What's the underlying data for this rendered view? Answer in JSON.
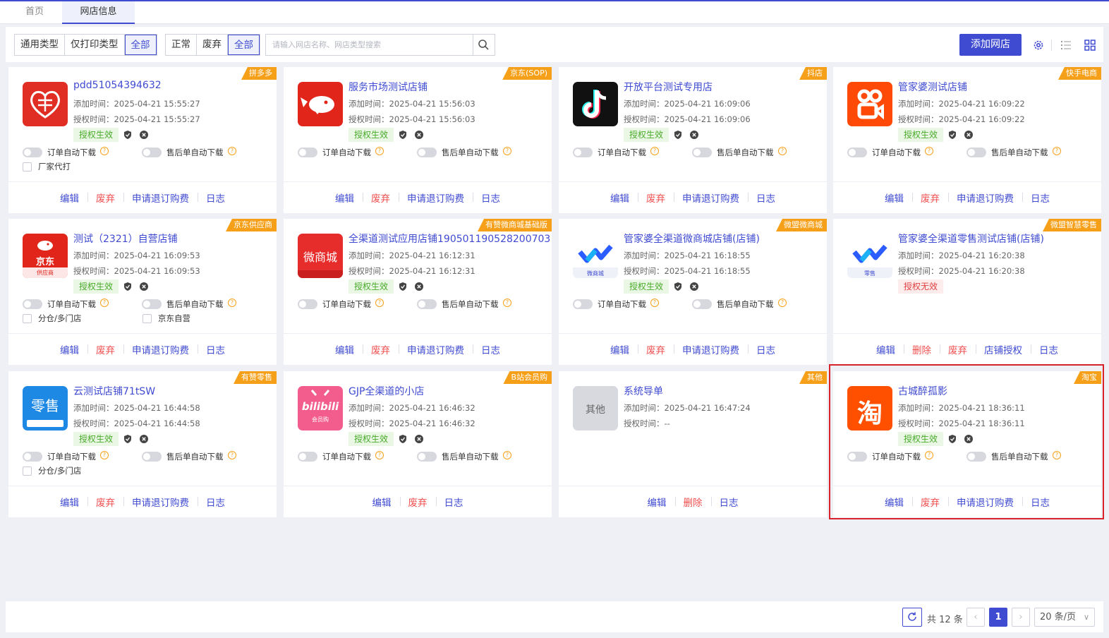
{
  "tabs": [
    {
      "label": "首页"
    },
    {
      "label": "网店信息"
    }
  ],
  "filters": {
    "type": [
      "通用类型",
      "仅打印类型",
      "全部"
    ],
    "status": [
      "正常",
      "废弃",
      "全部"
    ],
    "search_placeholder": "请输入网店名称、网店类型搜索",
    "add_label": "添加网店"
  },
  "labels": {
    "added": "添加时间：",
    "authed": "授权时间：",
    "order_auto": "订单自动下载",
    "after_auto": "售后单自动下载"
  },
  "cards": [
    {
      "badge": "拼多多",
      "name": "pdd51054394632",
      "added": "2025-04-21 15:55:27",
      "authed": "2025-04-21 15:55:27",
      "auth": "授权生效",
      "checks": [
        "厂家代打"
      ],
      "actions": [
        "编辑",
        "废弃",
        "申请退订购费",
        "日志"
      ],
      "logo": "pinduoduo-logo"
    },
    {
      "badge": "京东(SOP)",
      "name": "服务市场测试店铺",
      "added": "2025-04-21 15:56:03",
      "authed": "2025-04-21 15:56:03",
      "auth": "授权生效",
      "checks": [],
      "actions": [
        "编辑",
        "废弃",
        "申请退订购费",
        "日志"
      ],
      "logo": "jd-logo"
    },
    {
      "badge": "抖店",
      "name": "开放平台测试专用店",
      "added": "2025-04-21 16:09:06",
      "authed": "2025-04-21 16:09:06",
      "auth": "授权生效",
      "checks": [],
      "actions": [
        "编辑",
        "废弃",
        "申请退订购费",
        "日志"
      ],
      "logo": "douyin-logo"
    },
    {
      "badge": "快手电商",
      "name": "管家婆测试店铺",
      "added": "2025-04-21 16:09:22",
      "authed": "2025-04-21 16:09:22",
      "auth": "授权生效",
      "checks": [],
      "actions": [
        "编辑",
        "废弃",
        "申请退订购费",
        "日志"
      ],
      "logo": "kuaishou-logo"
    },
    {
      "badge": "京东供应商",
      "name": "测试（2321）自营店铺",
      "added": "2025-04-21 16:09:53",
      "authed": "2025-04-21 16:09:53",
      "auth": "授权生效",
      "checks": [
        "分仓/多门店",
        "京东自营"
      ],
      "actions": [
        "编辑",
        "废弃",
        "申请退订购费",
        "日志"
      ],
      "logo": "jd-supplier-logo",
      "logo_text": "京东",
      "logo_sub": "供应商"
    },
    {
      "badge": "有赞微商城基础版",
      "name": "全渠道测试应用店铺190501190528200703",
      "added": "2025-04-21 16:12:31",
      "authed": "2025-04-21 16:12:31",
      "auth": "授权生效",
      "checks": [],
      "actions": [
        "编辑",
        "废弃",
        "申请退订购费",
        "日志"
      ],
      "logo": "youzan-weishangcheng-logo",
      "logo_text": "微商城"
    },
    {
      "badge": "微盟微商城",
      "name": "管家婆全渠道微商城店铺(店铺)",
      "added": "2025-04-21 16:18:55",
      "authed": "2025-04-21 16:18:55",
      "auth": "授权生效",
      "checks": [],
      "actions": [
        "编辑",
        "废弃",
        "申请退订购费",
        "日志"
      ],
      "logo": "weimob-mall-logo",
      "logo_sub": "微商城"
    },
    {
      "badge": "微盟智慧零售",
      "name": "管家婆全渠道零售测试店铺(店铺)",
      "added": "2025-04-21 16:20:38",
      "authed": "2025-04-21 16:20:38",
      "auth": "授权无效",
      "auth_bad": true,
      "no_toggles": true,
      "checks": [],
      "actions": [
        "编辑",
        "删除",
        "废弃",
        "店铺授权",
        "日志"
      ],
      "logo": "weimob-retail-logo",
      "logo_sub": "零售"
    },
    {
      "badge": "有赞零售",
      "name": "云测试店铺71tSW",
      "added": "2025-04-21 16:44:58",
      "authed": "2025-04-21 16:44:58",
      "auth": "授权生效",
      "checks": [
        "分仓/多门店"
      ],
      "actions": [
        "编辑",
        "废弃",
        "申请退订购费",
        "日志"
      ],
      "logo": "youzan-retail-logo",
      "logo_text": "零售"
    },
    {
      "badge": "B站会员购",
      "name": "GJP全渠道的小店",
      "added": "2025-04-21 16:46:32",
      "authed": "2025-04-21 16:46:32",
      "auth": "授权生效",
      "checks": [],
      "actions": [
        "编辑",
        "废弃",
        "日志"
      ],
      "logo": "bilibili-logo",
      "logo_text": "bilibili",
      "logo_sub": "会员购"
    },
    {
      "badge": "其他",
      "name": "系统导单",
      "added": "2025-04-21 16:47:24",
      "authed": "--",
      "auth": "",
      "no_toggles": true,
      "checks": [],
      "actions": [
        "编辑",
        "删除",
        "日志"
      ],
      "logo": "other-logo",
      "logo_text": "其他"
    },
    {
      "badge": "淘宝",
      "name": "古城醉孤影",
      "added": "2025-04-21 18:36:11",
      "authed": "2025-04-21 18:36:11",
      "auth": "授权生效",
      "checks": [],
      "actions": [
        "编辑",
        "废弃",
        "申请退订购费",
        "日志"
      ],
      "logo": "taobao-logo",
      "logo_text": "淘",
      "selected": true
    }
  ],
  "pagination": {
    "total_text": "共 12 条",
    "page": "1",
    "size": "20 条/页"
  },
  "colors": {
    "accent": "#3f4bd1",
    "badge": "#f6a01a",
    "danger": "#f05050",
    "ok": "#4aab2b",
    "selection": "#d9232b"
  }
}
